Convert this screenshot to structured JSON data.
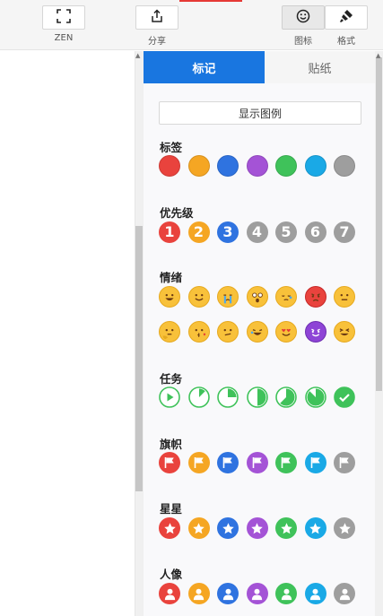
{
  "toolbar": {
    "zen_label": "ZEN",
    "share_label": "分享",
    "icon_label": "图标",
    "format_label": "格式"
  },
  "tabs": {
    "markers": "标记",
    "stickers": "贴纸"
  },
  "legend_button": "显示图例",
  "sections": {
    "tags": {
      "title": "标签",
      "colors": [
        "#e9433d",
        "#f5a623",
        "#2f73e0",
        "#a453d6",
        "#3fc25a",
        "#1aa9e6",
        "#9e9e9e"
      ]
    },
    "priority": {
      "title": "优先级",
      "values": [
        "1",
        "2",
        "3",
        "4",
        "5",
        "6",
        "7"
      ],
      "colors": [
        "#e9433d",
        "#f5a623",
        "#2f73e0",
        "#9e9e9e",
        "#9e9e9e",
        "#9e9e9e",
        "#9e9e9e"
      ]
    },
    "mood": {
      "title": "情绪",
      "icons": [
        "grinning-face-icon",
        "smiling-face-icon",
        "crying-face-icon",
        "astonished-face-icon",
        "sleepy-face-icon",
        "angry-face-icon",
        "neutral-face-icon",
        "thinking-face-icon",
        "kissing-face-icon",
        "confused-face-icon",
        "laughing-face-icon",
        "heart-eyes-face-icon",
        "devil-face-icon",
        "squinting-face-icon"
      ]
    },
    "task": {
      "title": "任务",
      "progress": [
        0,
        0.125,
        0.25,
        0.5,
        0.625,
        0.875,
        1
      ],
      "color": "#3fc25a"
    },
    "flag": {
      "title": "旗帜",
      "colors": [
        "#e9433d",
        "#f5a623",
        "#2f73e0",
        "#a453d6",
        "#3fc25a",
        "#1aa9e6",
        "#9e9e9e"
      ]
    },
    "star": {
      "title": "星星",
      "colors": [
        "#e9433d",
        "#f5a623",
        "#2f73e0",
        "#a453d6",
        "#3fc25a",
        "#1aa9e6",
        "#9e9e9e"
      ]
    },
    "person": {
      "title": "人像",
      "colors": [
        "#e9433d",
        "#f5a623",
        "#2f73e0",
        "#a453d6",
        "#3fc25a",
        "#1aa9e6",
        "#9e9e9e"
      ]
    }
  }
}
